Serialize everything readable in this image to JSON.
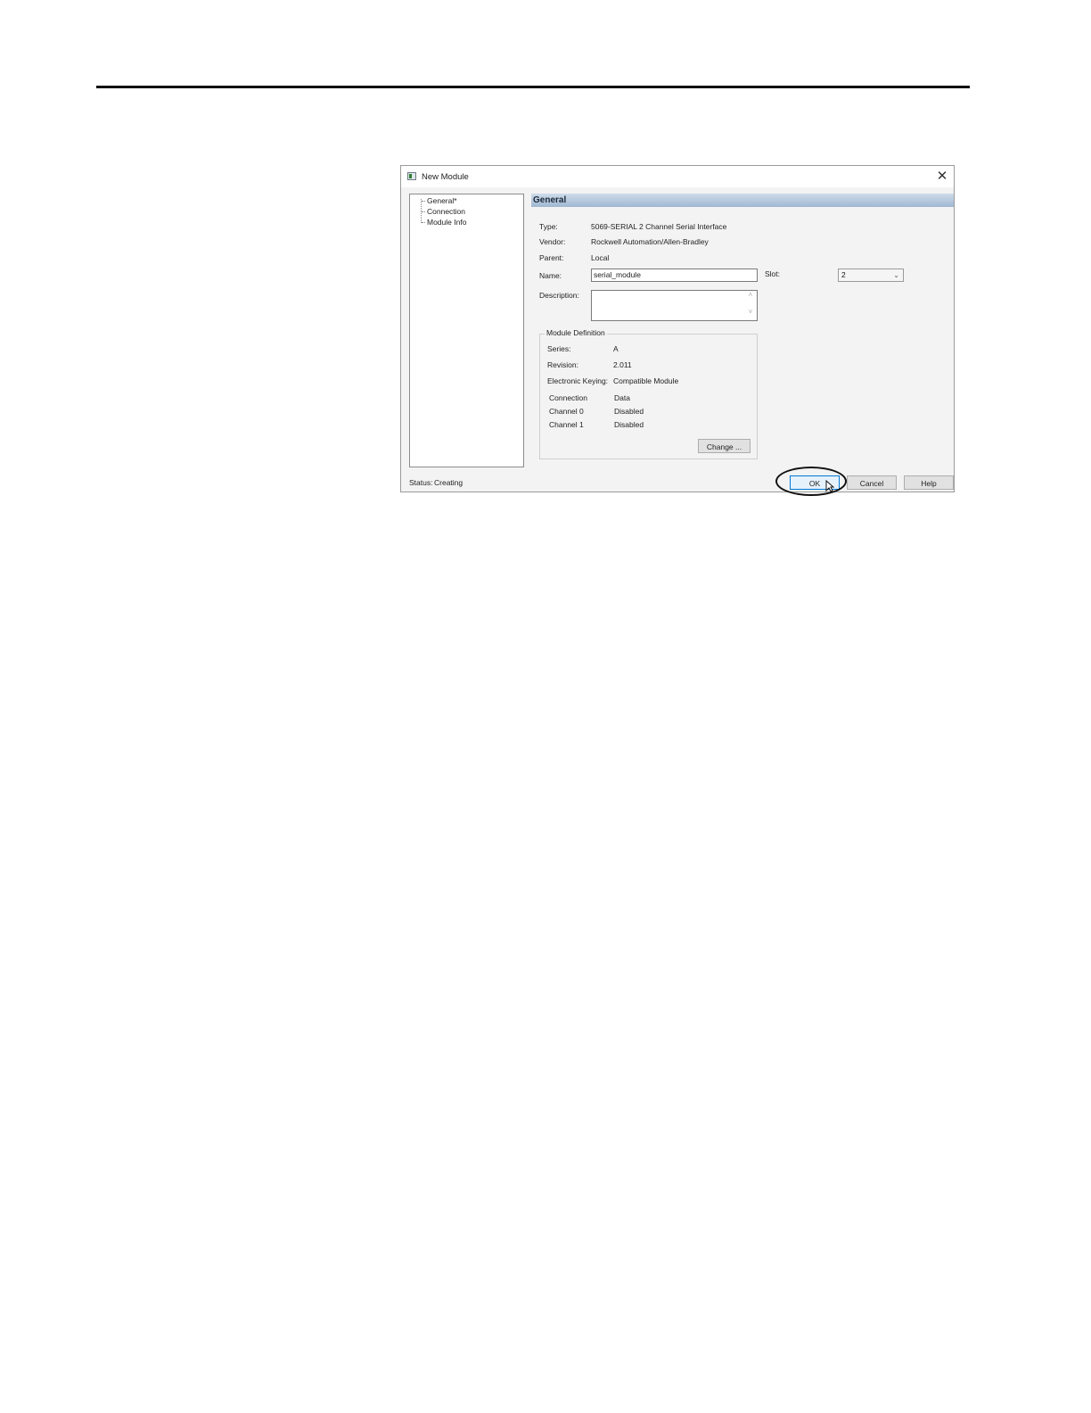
{
  "dialog": {
    "title": "New Module",
    "close_glyph": "✕",
    "tree": [
      "General*",
      "Connection",
      "Module Info"
    ],
    "section_title": "General",
    "fields": {
      "type_label": "Type:",
      "type_value": "5069-SERIAL 2 Channel Serial Interface",
      "vendor_label": "Vendor:",
      "vendor_value": "Rockwell Automation/Allen-Bradley",
      "parent_label": "Parent:",
      "parent_value": "Local",
      "name_label": "Name:",
      "name_value": "serial_module",
      "slot_label": "Slot:",
      "slot_value": "2",
      "description_label": "Description:",
      "description_value": ""
    },
    "module_definition": {
      "title": "Module Definition",
      "series_label": "Series:",
      "series_value": "A",
      "revision_label": "Revision:",
      "revision_value": "2.011",
      "keying_label": "Electronic Keying:",
      "keying_value": "Compatible Module",
      "rows": [
        {
          "label": "Connection",
          "value": "Data"
        },
        {
          "label": "Channel 0",
          "value": "Disabled"
        },
        {
          "label": "Channel 1",
          "value": "Disabled"
        }
      ],
      "change_button": "Change ..."
    },
    "status_label": "Status:",
    "status_value": "Creating",
    "buttons": {
      "ok": "OK",
      "cancel": "Cancel",
      "help": "Help"
    }
  },
  "icons": {
    "app": "module-icon",
    "close": "close-icon",
    "dropdown": "chevron-down-icon",
    "cursor": "mouse-pointer-icon"
  }
}
